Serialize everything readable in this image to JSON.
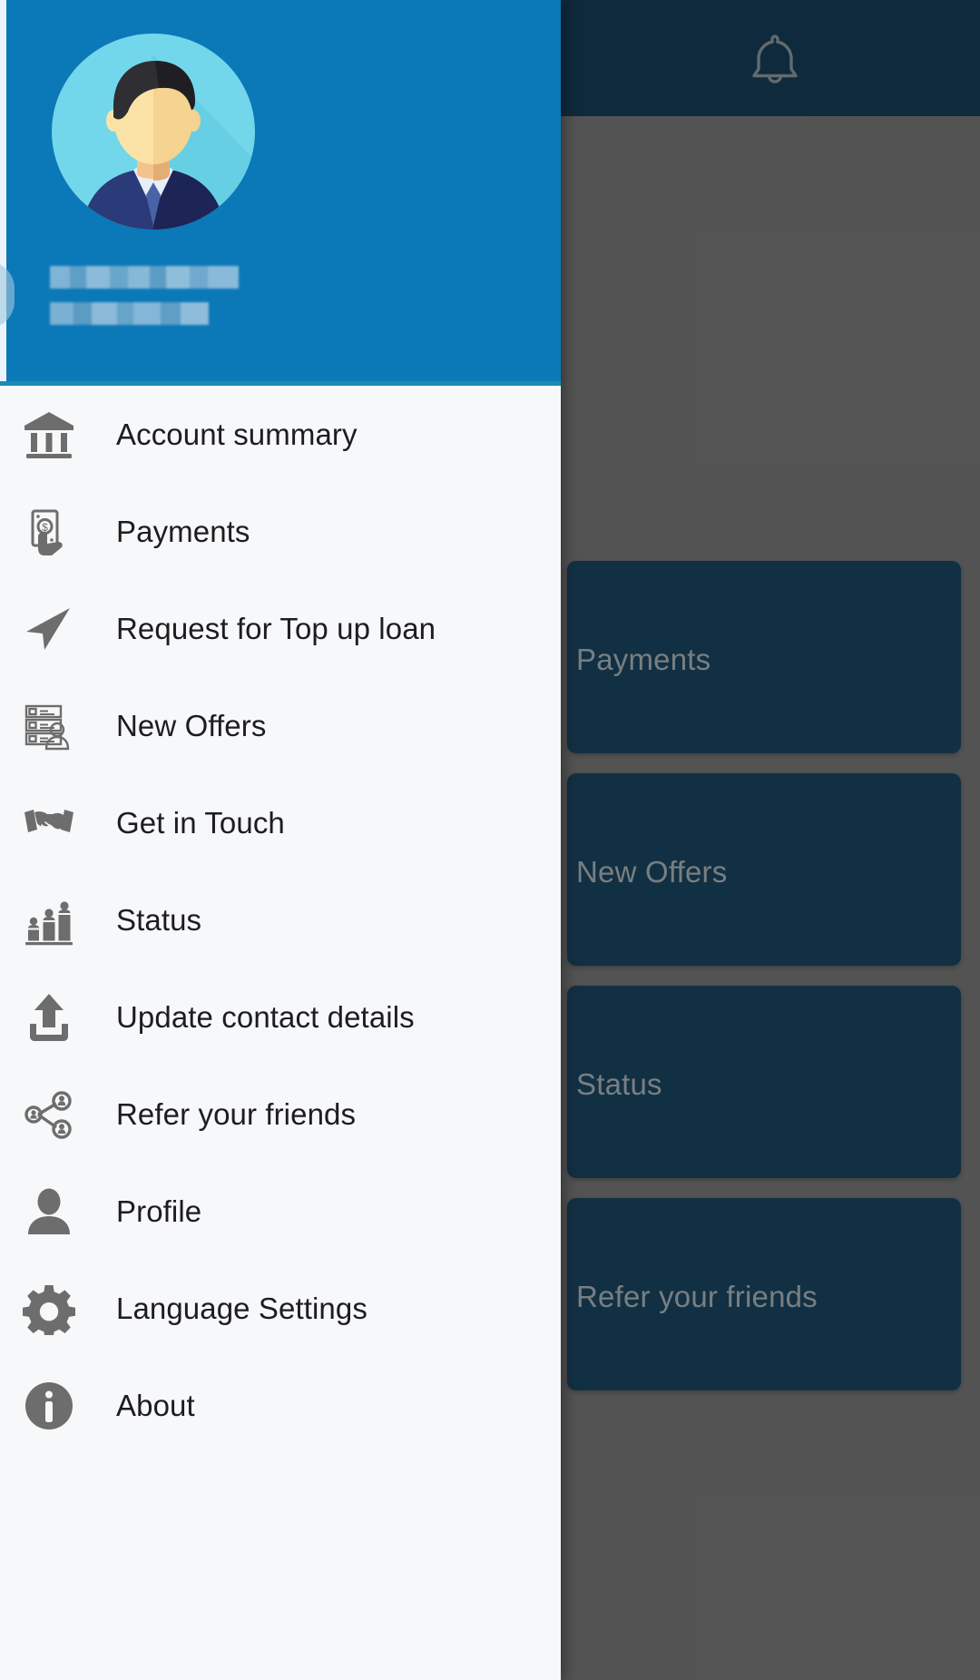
{
  "app": {
    "accent_blue": "#0b78b8",
    "appbar_navy": "#0a3049",
    "card_navy": "#0d3953",
    "scrim_grey": "#6b6b6b",
    "menu_bg": "#f7f8f9",
    "icon_grey": "#6d6d6d",
    "label_color": "#1d1d1f"
  },
  "appbar": {
    "notification_icon": "bell-icon"
  },
  "drawer": {
    "header": {
      "avatar_icon": "user-avatar-illustration",
      "user_name": "",
      "user_subtitle": "",
      "name_redacted": true,
      "subtitle_redacted": true
    },
    "items": [
      {
        "label": "Account summary",
        "icon": "bank-building-icon"
      },
      {
        "label": "Payments",
        "icon": "hand-money-icon"
      },
      {
        "label": "Request for Top up loan",
        "icon": "send-arrow-icon"
      },
      {
        "label": "New Offers",
        "icon": "checklist-person-icon"
      },
      {
        "label": "Get in Touch",
        "icon": "handshake-icon"
      },
      {
        "label": "Status",
        "icon": "bar-chart-people-icon"
      },
      {
        "label": "Update contact details",
        "icon": "upload-icon"
      },
      {
        "label": "Refer your friends",
        "icon": "share-network-icon"
      },
      {
        "label": "Profile",
        "icon": "person-icon"
      },
      {
        "label": "Language Settings",
        "icon": "gear-icon"
      },
      {
        "label": "About",
        "icon": "info-icon"
      }
    ]
  },
  "background_content": {
    "cards": [
      {
        "label": "Payments"
      },
      {
        "label": "New Offers"
      },
      {
        "label": "Status"
      },
      {
        "label": "Refer your friends"
      }
    ]
  }
}
